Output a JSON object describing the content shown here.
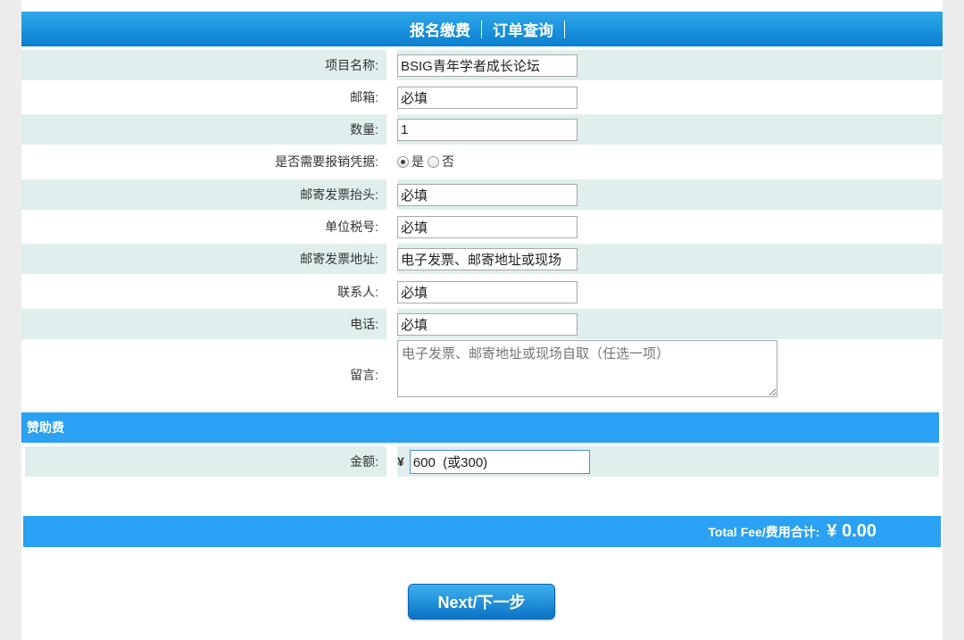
{
  "nav": {
    "tabs": [
      "报名缴费",
      "订单查询"
    ]
  },
  "form": {
    "project": {
      "label": "项目名称:",
      "value": "BSIG青年学者成长论坛"
    },
    "email": {
      "label": "邮箱:",
      "value": "必填"
    },
    "quantity": {
      "label": "数量:",
      "value": "1"
    },
    "receipt": {
      "label": "是否需要报销凭据:",
      "option_yes": "是",
      "option_no": "否",
      "selected": "是"
    },
    "invoice_title": {
      "label": "邮寄发票抬头:",
      "value": "必填"
    },
    "tax_id": {
      "label": "单位税号:",
      "value": "必填"
    },
    "invoice_address": {
      "label": "邮寄发票地址:",
      "value": "电子发票、邮寄地址或现场"
    },
    "contact": {
      "label": "联系人:",
      "value": "必填"
    },
    "phone": {
      "label": "电话:",
      "value": "必填"
    },
    "message": {
      "label": "留言:",
      "placeholder": "电子发票、邮寄地址或现场自取（任选一项）"
    }
  },
  "sponsor": {
    "title": "赞助费",
    "amount_label": "金额:",
    "currency": "¥",
    "amount_value": "600  (或300)"
  },
  "total": {
    "label": "Total Fee/费用合计:",
    "value": "¥ 0.00"
  },
  "next_button": "Next/下一步",
  "colors": {
    "header_blue": "#0a7fd0",
    "section_blue": "#2aa1f2",
    "row_shade": "#e1eeee"
  }
}
